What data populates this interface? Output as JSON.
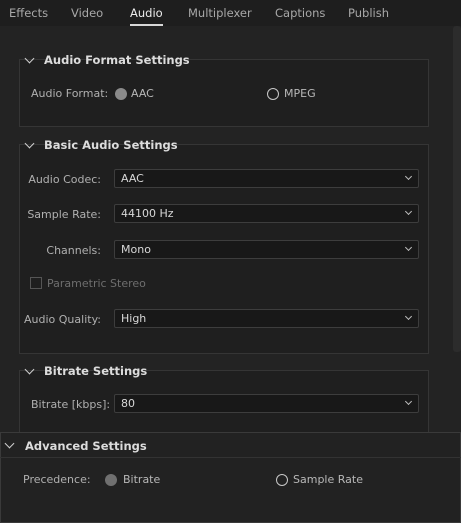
{
  "tabs": [
    {
      "label": "Effects",
      "active": false
    },
    {
      "label": "Video",
      "active": false
    },
    {
      "label": "Audio",
      "active": true
    },
    {
      "label": "Multiplexer",
      "active": false
    },
    {
      "label": "Captions",
      "active": false
    },
    {
      "label": "Publish",
      "active": false
    }
  ],
  "audio_format": {
    "title": "Audio Format Settings",
    "label": "Audio Format:",
    "options": [
      {
        "label": "AAC",
        "selected": true
      },
      {
        "label": "MPEG",
        "selected": false
      }
    ]
  },
  "basic_audio": {
    "title": "Basic Audio Settings",
    "codec": {
      "label": "Audio Codec:",
      "value": "AAC"
    },
    "sample_rate": {
      "label": "Sample Rate:",
      "value": "44100 Hz"
    },
    "channels": {
      "label": "Channels:",
      "value": "Mono"
    },
    "parametric_stereo": {
      "label": "Parametric Stereo",
      "checked": false,
      "enabled": false
    },
    "quality": {
      "label": "Audio Quality:",
      "value": "High"
    }
  },
  "bitrate": {
    "title": "Bitrate Settings",
    "label": "Bitrate [kbps]:",
    "value": "80"
  },
  "advanced": {
    "title": "Advanced Settings",
    "precedence_label": "Precedence:",
    "options": [
      {
        "label": "Bitrate",
        "selected": true
      },
      {
        "label": "Sample Rate",
        "selected": false
      }
    ]
  },
  "colors": {
    "background": "#232323",
    "panel": "#1f1f1f",
    "text": "#b4b4b4",
    "active_tab": "#ececec"
  }
}
